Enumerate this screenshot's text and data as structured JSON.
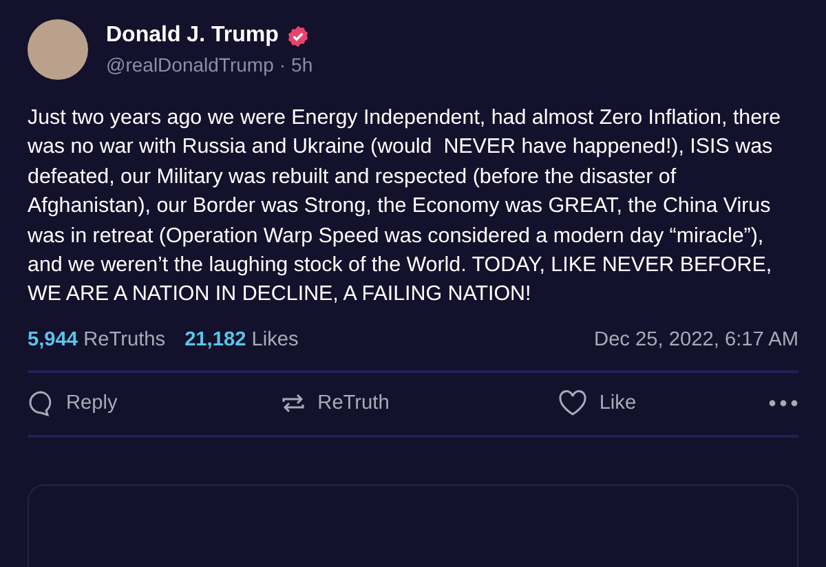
{
  "post": {
    "author": {
      "name": "Donald J. Trump",
      "verified": true,
      "handle": "@realDonaldTrump",
      "separator": "·",
      "time": "5h"
    },
    "text": "Just two years ago we were Energy Independent, had almost Zero Inflation, there was no war with Russia and Ukraine (would  NEVER have happened!), ISIS was defeated, our Military was rebuilt and respected (before the disaster of Afghanistan), our Border was Strong, the Economy was GREAT, the China Virus was in retreat (Operation Warp Speed was considered a modern day “miracle”), and we weren’t the laughing stock of the World. TODAY, LIKE NEVER BEFORE, WE ARE A NATION IN DECLINE, A FAILING NATION!",
    "stats": [
      {
        "count": "5,944",
        "label": "ReTruths"
      },
      {
        "count": "21,182",
        "label": "Likes"
      }
    ],
    "date": "Dec 25, 2022, 6:17 AM",
    "actions": [
      {
        "kind": "reply",
        "label": "Reply"
      },
      {
        "kind": "retruth",
        "label": "ReTruth"
      },
      {
        "kind": "like",
        "label": "Like"
      },
      {
        "kind": "more"
      }
    ]
  }
}
